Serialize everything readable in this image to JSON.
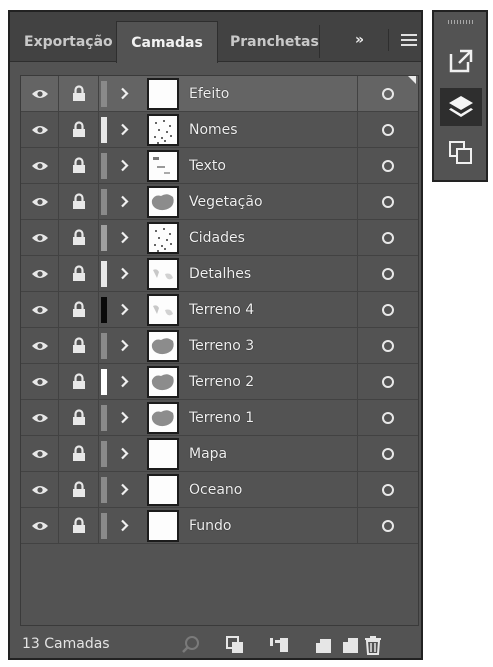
{
  "tabs": {
    "export": "Exportação",
    "layers": "Camadas",
    "artboards": "Pranchetas",
    "more": "»"
  },
  "layers": [
    {
      "name": "Efeito",
      "color": "#8a8a8a",
      "selected": true,
      "thumb": "blank"
    },
    {
      "name": "Nomes",
      "color": "#e8e8e8",
      "selected": false,
      "thumb": "dots"
    },
    {
      "name": "Texto",
      "color": "#8a8a8a",
      "selected": false,
      "thumb": "text"
    },
    {
      "name": "Vegetação",
      "color": "#8a8a8a",
      "selected": false,
      "thumb": "blob"
    },
    {
      "name": "Cidades",
      "color": "#a0a0a0",
      "selected": false,
      "thumb": "dots"
    },
    {
      "name": "Detalhes",
      "color": "#e8e8e8",
      "selected": false,
      "thumb": "faint"
    },
    {
      "name": "Terreno 4",
      "color": "#0a0a0a",
      "selected": false,
      "thumb": "faint"
    },
    {
      "name": "Terreno 3",
      "color": "#8a8a8a",
      "selected": false,
      "thumb": "blob"
    },
    {
      "name": "Terreno 2",
      "color": "#ffffff",
      "selected": false,
      "thumb": "blob"
    },
    {
      "name": "Terreno 1",
      "color": "#8a8a8a",
      "selected": false,
      "thumb": "blob"
    },
    {
      "name": "Mapa",
      "color": "#8a8a8a",
      "selected": false,
      "thumb": "blank"
    },
    {
      "name": "Oceano",
      "color": "#8a8a8a",
      "selected": false,
      "thumb": "blank"
    },
    {
      "name": "Fundo",
      "color": "#8a8a8a",
      "selected": false,
      "thumb": "blank"
    }
  ],
  "footer": {
    "count": "13 Camadas",
    "icons": [
      "search-icon",
      "collect-for-export-icon",
      "make-clipping-mask-icon",
      "new-sublayer-icon",
      "new-layer-icon",
      "delete-icon"
    ]
  },
  "dock": {
    "icons": [
      "export-icon",
      "layers-icon",
      "artboards-icon"
    ]
  }
}
